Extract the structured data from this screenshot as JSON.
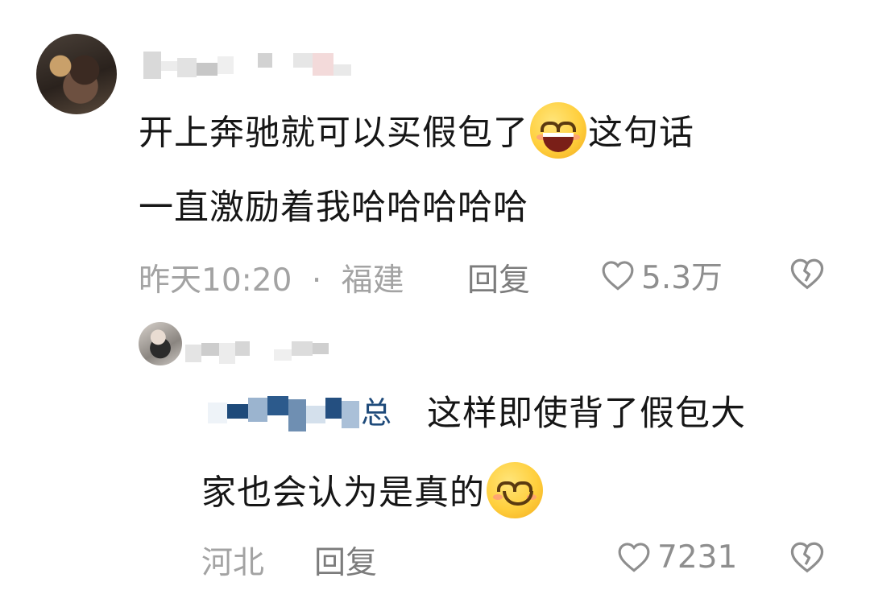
{
  "comment": {
    "avatar_icon": "user-avatar-photo",
    "text_line1_before_emoji": "开上奔驰就可以买假包了",
    "emoji_1": "grinning-squinting-face-emoji",
    "text_line1_after_emoji": "这句话",
    "text_line2": "一直激励着我哈哈哈哈哈",
    "time": "昨天10:20",
    "separator": "·",
    "location": "福建",
    "reply_label": "回复",
    "like_icon": "heart-outline-icon",
    "like_count": "5.3万",
    "dislike_icon": "broken-heart-icon"
  },
  "reply": {
    "avatar_icon": "user-avatar-photo",
    "mention_tail": "总",
    "text_line1": "这样即使背了假包大",
    "text_line2_before_emoji": "家也会认为是真的",
    "emoji_2": "smiling-face-emoji",
    "location": "河北",
    "reply_label": "回复",
    "like_icon": "heart-outline-icon",
    "like_count": "7231",
    "dislike_icon": "broken-heart-icon"
  },
  "colors": {
    "text": "#161616",
    "meta": "#a3a3a3",
    "reply_btn": "#7c7c7c",
    "mention_blue": "#1e4a7a"
  }
}
